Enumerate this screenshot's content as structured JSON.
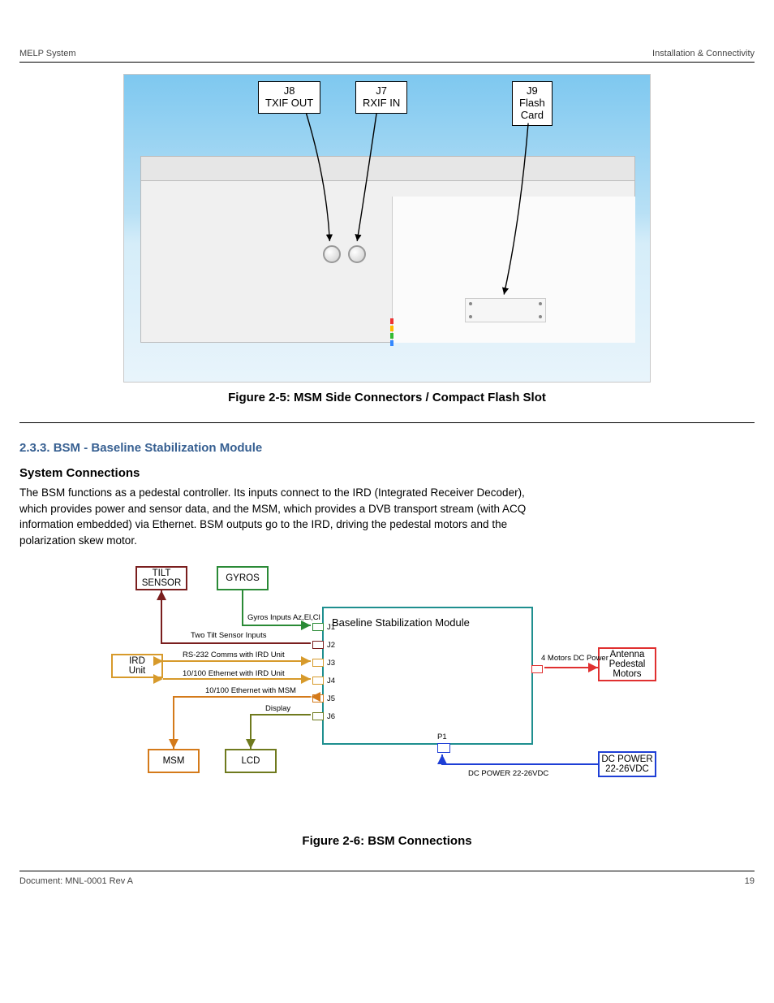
{
  "header": {
    "left": "MELP System",
    "right": "Installation & Connectivity"
  },
  "figure1": {
    "callouts": {
      "j8": "J8\nTXIF OUT",
      "j7": "J7\nRXIF IN",
      "j9": "J9\nFlash\nCard"
    },
    "caption": "Figure 2-5: MSM Side Connectors / Compact Flash Slot"
  },
  "section": {
    "number": "2.3.3.",
    "title": "BSM - Baseline Stabilization Module",
    "subheading": "System Connections",
    "paragraph": "The BSM functions as a pedestal controller. Its inputs connect to the IRD (Integrated Receiver Decoder), which provides power and sensor data, and the MSM, which provides a DVB transport stream (with ACQ information embedded) via Ethernet. BSM outputs go to the IRD, driving the pedestal motors and the polarization skew motor."
  },
  "diagram": {
    "mainbox": {
      "title": "Baseline Stabilization Module",
      "stubs": {
        "j1": "J1",
        "j2": "J2",
        "j3": "J3",
        "j4": "J4",
        "j5": "J5",
        "j6": "J6",
        "p1": "P1"
      }
    },
    "labels": {
      "tilt": "TILT\nSENSOR",
      "gyros": "GYROS",
      "ird": "IRD\nUnit",
      "msm": "MSM",
      "lcd": "LCD",
      "dc": "DC POWER\n22-26VDC",
      "antenna": "Antenna\nPedestal\nMotors"
    },
    "wires": {
      "gyros": "Gyros Inputs Az,El,Cl",
      "tilt": "Two Tilt Sensor Inputs",
      "ird_top": "RS-232 Comms with IRD Unit",
      "ird_bot": "10/100 Ethernet with IRD Unit",
      "msm": "10/100 Ethernet with MSM",
      "lcd": "Display",
      "antenna": "4 Motors DC Power",
      "dc": "DC POWER 22-26VDC"
    }
  },
  "figure2_caption": "Figure 2-6: BSM Connections",
  "footer": {
    "left": "Document: MNL-0001 Rev A",
    "right": "19"
  }
}
